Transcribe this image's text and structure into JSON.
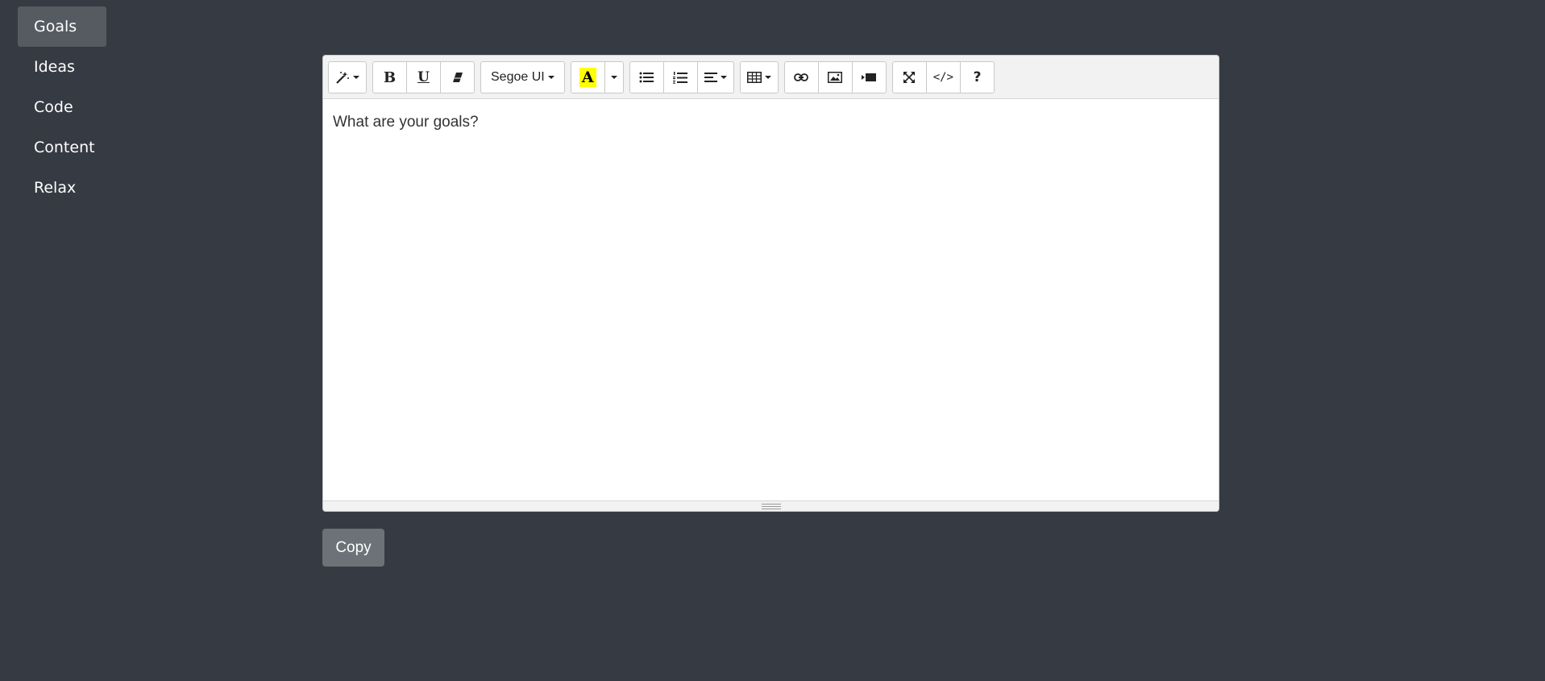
{
  "sidebar": {
    "items": [
      {
        "label": "Goals",
        "active": true
      },
      {
        "label": "Ideas",
        "active": false
      },
      {
        "label": "Code",
        "active": false
      },
      {
        "label": "Content",
        "active": false
      },
      {
        "label": "Relax",
        "active": false
      }
    ]
  },
  "editor": {
    "toolbar": {
      "style_icon": "magic-wand-icon",
      "bold_label": "B",
      "underline_label": "U",
      "clear_format_icon": "eraser-icon",
      "font_name": "Segoe UI",
      "color_label": "A",
      "highlight_color": "#ffff00",
      "code_view_label": "</>",
      "help_label": "?"
    },
    "content": "What are your goals?"
  },
  "copy_button": {
    "label": "Copy"
  },
  "colors": {
    "background": "#363a42",
    "active_nav": "#565b62",
    "copy_button": "#6c7278"
  }
}
